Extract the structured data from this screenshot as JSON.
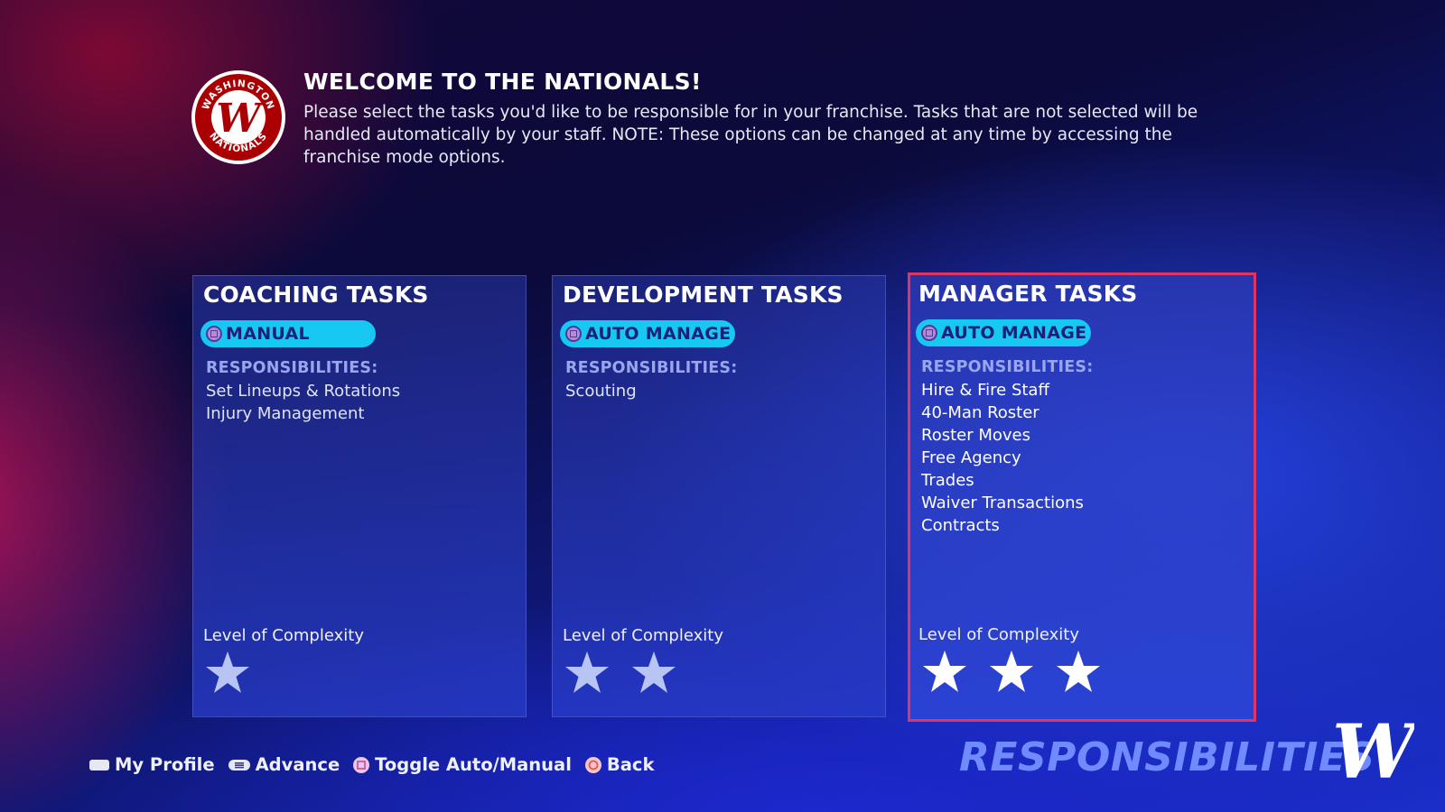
{
  "header": {
    "logo_text": "WASHINGTON NATIONALS",
    "title": "WELCOME TO THE NATIONALS!",
    "description": "Please select the tasks you'd like to be responsible for in your franchise. Tasks that are not selected will be handled automatically by your staff.  NOTE: These options can be changed at any time by accessing the franchise mode options."
  },
  "cards": [
    {
      "title": "COACHING TASKS",
      "toggle_label": "MANUAL",
      "responsibilities_label": "RESPONSIBILITIES:",
      "items": [
        "Set Lineups & Rotations",
        "Injury Management"
      ],
      "complexity_label": "Level of Complexity",
      "complexity_stars": 1
    },
    {
      "title": "DEVELOPMENT TASKS",
      "toggle_label": "AUTO MANAGE",
      "responsibilities_label": "RESPONSIBILITIES:",
      "items": [
        "Scouting"
      ],
      "complexity_label": "Level of Complexity",
      "complexity_stars": 2
    },
    {
      "title": "MANAGER TASKS",
      "toggle_label": "AUTO MANAGE",
      "responsibilities_label": "RESPONSIBILITIES:",
      "items": [
        "Hire & Fire Staff",
        "40-Man Roster",
        "Roster Moves",
        "Free Agency",
        "Trades",
        "Waiver Transactions",
        "Contracts"
      ],
      "complexity_label": "Level of Complexity",
      "complexity_stars": 3,
      "selected": true
    }
  ],
  "footer": {
    "my_profile": "My Profile",
    "advance": "Advance",
    "toggle": "Toggle Auto/Manual",
    "back": "Back"
  },
  "brand_title": "RESPONSIBILITIES",
  "colors": {
    "toggle_bg": "#16c8f2",
    "selected_border": "#e23462",
    "brand_text": "#6f8bff"
  }
}
